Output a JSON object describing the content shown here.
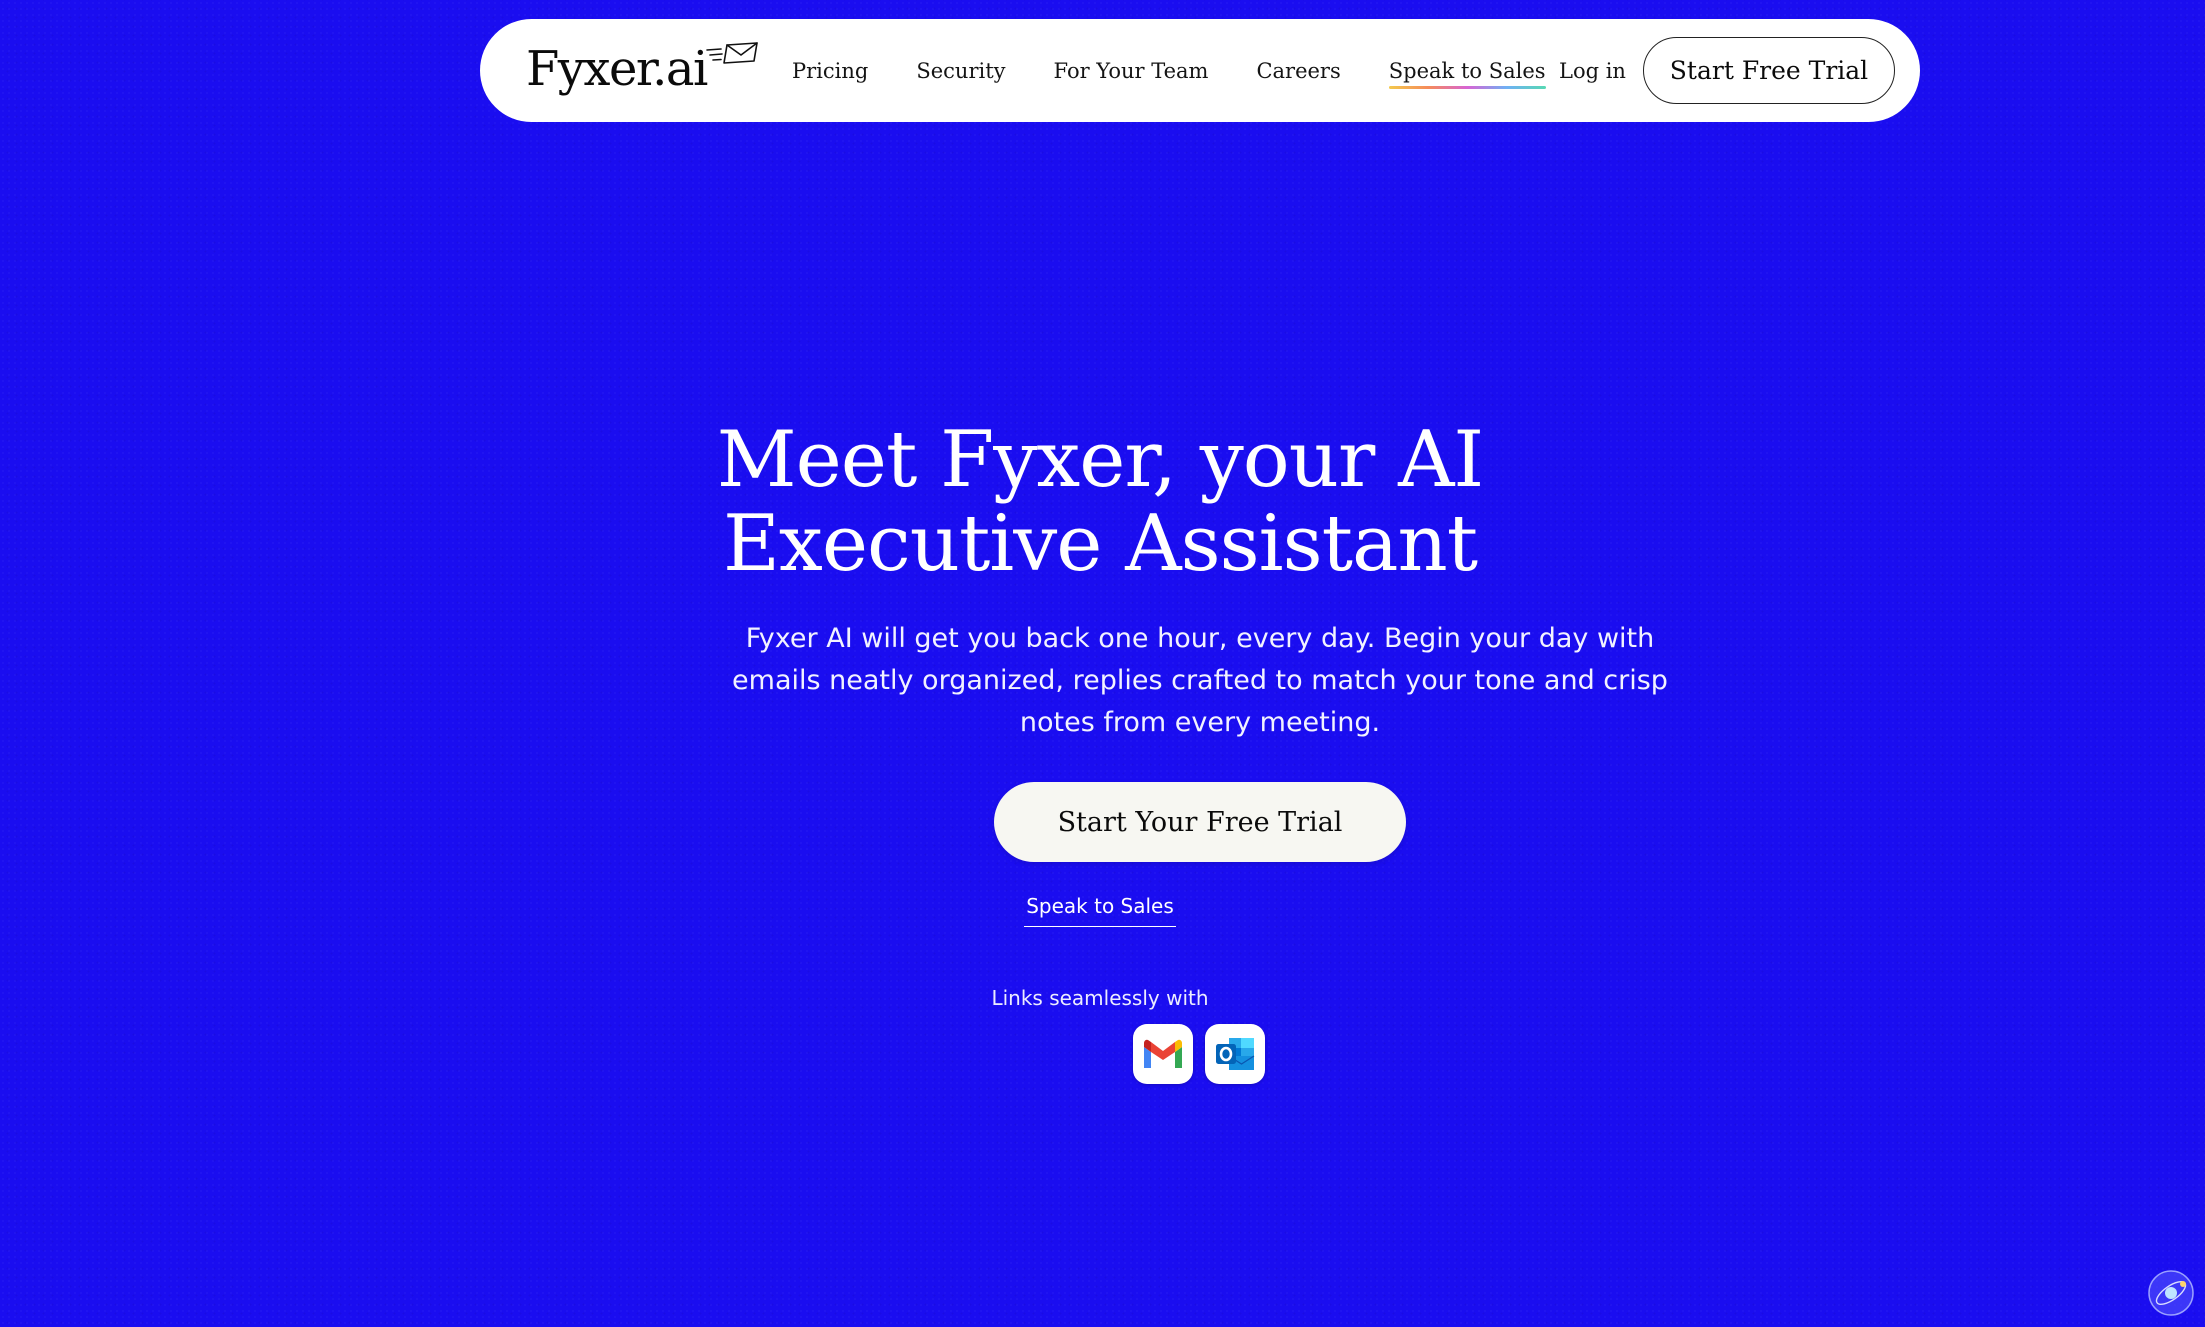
{
  "brand": {
    "logo_text": "Fyxer.ai",
    "logo_icon": "envelope-icon",
    "background_color": "#1a0df0"
  },
  "nav": {
    "links": [
      {
        "label": "Pricing"
      },
      {
        "label": "Security"
      },
      {
        "label": "For Your Team"
      },
      {
        "label": "Careers"
      },
      {
        "label": "Speak to Sales"
      }
    ],
    "login_label": "Log in",
    "cta_label": "Start Free Trial"
  },
  "hero": {
    "title_line1": "Meet Fyxer, your AI",
    "title_line2": "Executive Assistant",
    "subtitle": "Fyxer AI will get you back one hour, every day. Begin your day with emails neatly organized, replies crafted to match your tone and crisp notes from every meeting.",
    "cta_label": "Start Your Free Trial",
    "secondary_link": "Speak to Sales",
    "integrations_label": "Links seamlessly with",
    "integrations": [
      {
        "icon": "gmail-icon"
      },
      {
        "icon": "outlook-icon"
      }
    ]
  }
}
